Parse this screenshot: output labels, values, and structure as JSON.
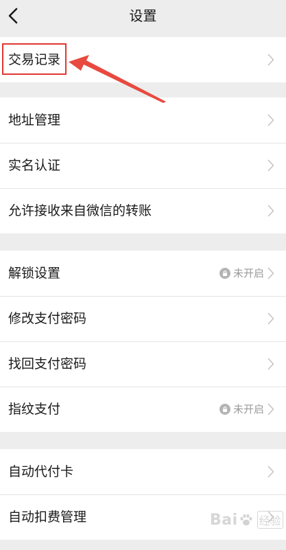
{
  "nav": {
    "title": "设置"
  },
  "groups": [
    {
      "items": [
        {
          "label": "交易记录"
        }
      ]
    },
    {
      "items": [
        {
          "label": "地址管理"
        },
        {
          "label": "实名认证"
        },
        {
          "label": "允许接收来自微信的转账"
        }
      ]
    },
    {
      "items": [
        {
          "label": "解锁设置",
          "status": "未开启"
        },
        {
          "label": "修改支付密码"
        },
        {
          "label": "找回支付密码"
        },
        {
          "label": "指纹支付",
          "status": "未开启"
        }
      ]
    },
    {
      "items": [
        {
          "label": "自动代付卡"
        },
        {
          "label": "自动扣费管理"
        }
      ]
    }
  ],
  "watermark": {
    "brand_left": "Bai",
    "brand_right": "经验",
    "brand_paw_icon": "paw-icon"
  },
  "colors": {
    "background": "#ededed",
    "row_background": "#ffffff",
    "annotation_red": "#e0372f",
    "secondary_text": "#9a9a9a"
  }
}
